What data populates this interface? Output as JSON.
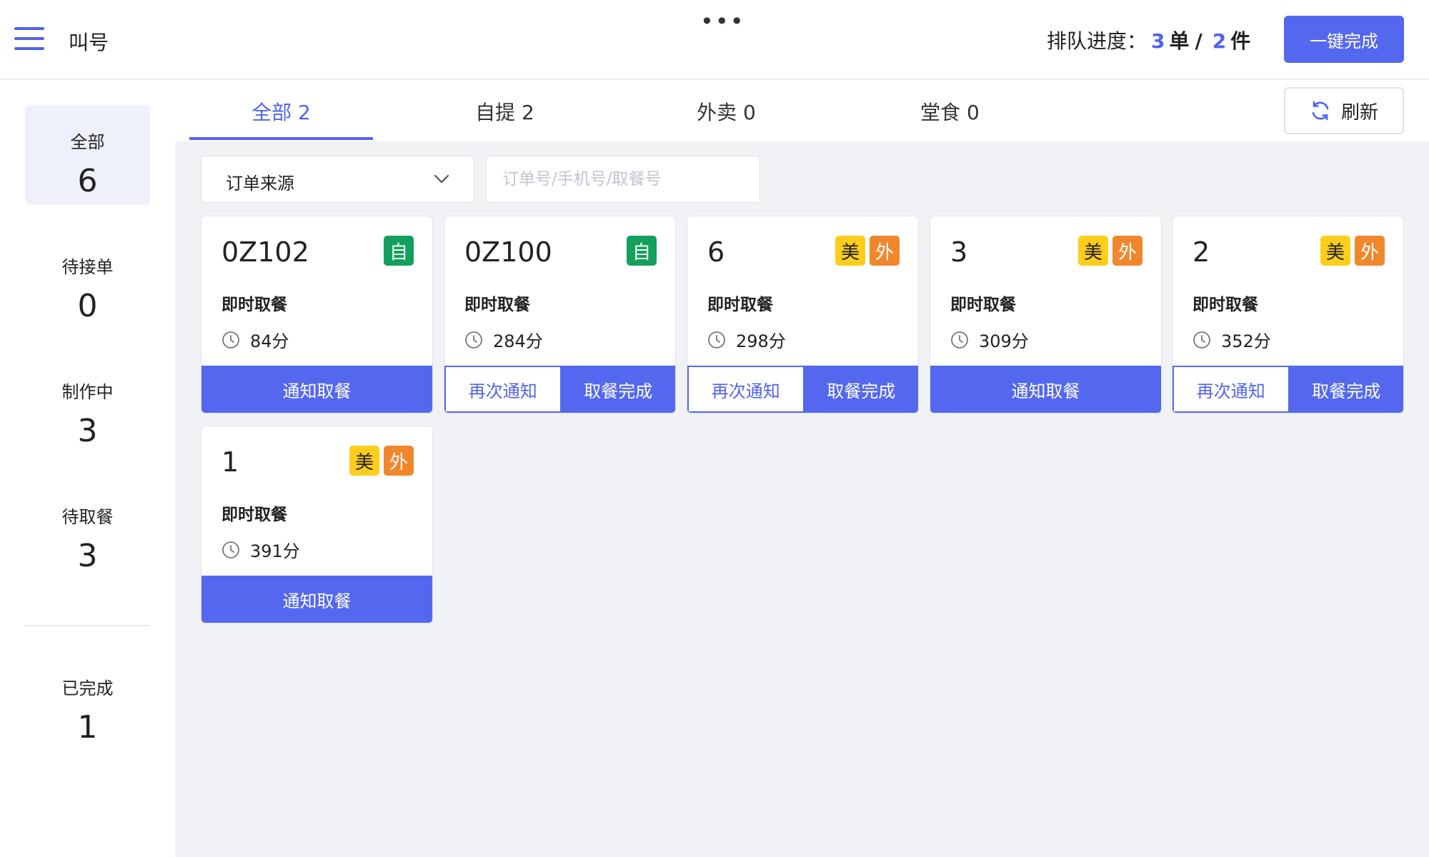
{
  "colors": {
    "accent": "#5468ef",
    "zi_badge": "#12a05c",
    "mei_badge": "#ffcd1c",
    "wai_badge": "#f0872c"
  },
  "header": {
    "title": "叫号",
    "more": "•••",
    "progress_label": "排队进度：",
    "progress_orders": "3",
    "progress_orders_unit": "单",
    "progress_sep": "/",
    "progress_items": "2",
    "progress_items_unit": "件",
    "complete_all": "一键完成"
  },
  "sidebar": {
    "items": [
      {
        "label": "全部",
        "count": "6",
        "active": true
      },
      {
        "label": "待接单",
        "count": "0"
      },
      {
        "label": "制作中",
        "count": "3"
      },
      {
        "label": "待取餐",
        "count": "3"
      },
      {
        "label": "已完成",
        "count": "1"
      }
    ]
  },
  "tabs": [
    {
      "label": "全部 2",
      "active": true
    },
    {
      "label": "自提 2"
    },
    {
      "label": "外卖 0"
    },
    {
      "label": "堂食 0"
    }
  ],
  "refresh_label": "刷新",
  "filter": {
    "source_label": "订单来源",
    "search_placeholder": "订单号/手机号/取餐号"
  },
  "cards": [
    {
      "number": "0Z102",
      "badges": [
        "自"
      ],
      "type": "即时取餐",
      "time": "84分",
      "actions": [
        "通知取餐"
      ]
    },
    {
      "number": "0Z100",
      "badges": [
        "自"
      ],
      "type": "即时取餐",
      "time": "284分",
      "actions": [
        "再次通知",
        "取餐完成"
      ]
    },
    {
      "number": "6",
      "badges": [
        "美",
        "外"
      ],
      "type": "即时取餐",
      "time": "298分",
      "actions": [
        "再次通知",
        "取餐完成"
      ]
    },
    {
      "number": "3",
      "badges": [
        "美",
        "外"
      ],
      "type": "即时取餐",
      "time": "309分",
      "actions": [
        "通知取餐"
      ]
    },
    {
      "number": "2",
      "badges": [
        "美",
        "外"
      ],
      "type": "即时取餐",
      "time": "352分",
      "actions": [
        "再次通知",
        "取餐完成"
      ]
    },
    {
      "number": "1",
      "badges": [
        "美",
        "外"
      ],
      "type": "即时取餐",
      "time": "391分",
      "actions": [
        "通知取餐"
      ]
    }
  ]
}
